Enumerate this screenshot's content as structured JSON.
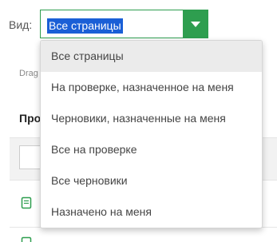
{
  "view": {
    "label": "Вид:",
    "selected_value": "Все страницы"
  },
  "background": {
    "drag_hint": "Drag",
    "section_heading": "Про"
  },
  "dropdown": {
    "items": [
      {
        "label": "Все страницы",
        "selected": true
      },
      {
        "label": "На проверке, назначенное на меня",
        "selected": false
      },
      {
        "label": "Черновики, назначенные на меня",
        "selected": false
      },
      {
        "label": "Все на проверке",
        "selected": false
      },
      {
        "label": "Все черновики",
        "selected": false
      },
      {
        "label": "Назначено на меня",
        "selected": false
      }
    ]
  },
  "colors": {
    "accent": "#2e9e4f",
    "selection": "#1a5fd6",
    "hover_row": "#ebebeb"
  },
  "icons": {
    "select_toggle": "chevron-down-icon",
    "row_icon": "document-icon"
  }
}
